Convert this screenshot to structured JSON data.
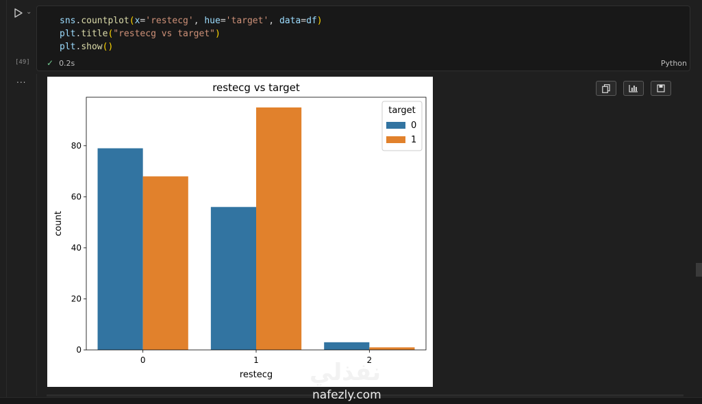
{
  "cell": {
    "execution_count": "[49]",
    "status_time": "0.2s",
    "language": "Python",
    "code": {
      "l1_obj": "sns",
      "l1_fn": "countplot",
      "l1_k1": "x",
      "l1_v1": "'restecg'",
      "l1_k2": "hue",
      "l1_v2": "'target'",
      "l1_k3": "data",
      "l1_v3": "df",
      "l2_obj": "plt",
      "l2_fn": "title",
      "l2_str": "\"restecg vs target\"",
      "l3_obj": "plt",
      "l3_fn": "show"
    }
  },
  "output": {
    "more_label": "...",
    "toolbar": [
      {
        "name": "copy-output-button",
        "icon": "copy-icon"
      },
      {
        "name": "open-plot-button",
        "icon": "chart-icon"
      },
      {
        "name": "save-output-button",
        "icon": "save-icon"
      }
    ]
  },
  "chart_data": {
    "type": "bar",
    "title": "restecg vs target",
    "xlabel": "restecg",
    "ylabel": "count",
    "categories": [
      "0",
      "1",
      "2"
    ],
    "series": [
      {
        "name": "0",
        "values": [
          79,
          56,
          3
        ],
        "color": "#3274a1"
      },
      {
        "name": "1",
        "values": [
          68,
          95,
          1
        ],
        "color": "#e1812c"
      }
    ],
    "ylim": [
      0,
      99
    ],
    "yticks": [
      0,
      20,
      40,
      60,
      80
    ],
    "legend": {
      "title": "target",
      "placement": "top-right"
    },
    "grid": false
  },
  "watermark": {
    "arabic": "نفذلي",
    "latin": "nafezly.com"
  }
}
